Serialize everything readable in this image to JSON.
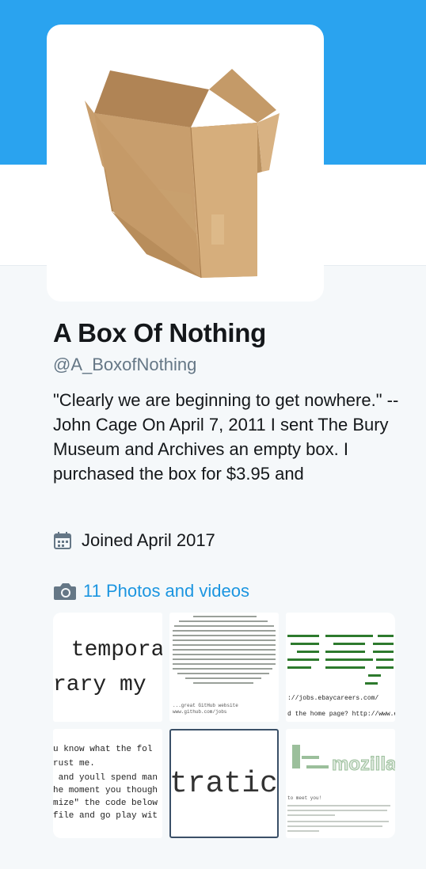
{
  "profile": {
    "name": "A Box Of Nothing",
    "handle": "@A_BoxofNothing",
    "bio": "\"Clearly we are beginning to get nowhere.\" --John Cage On April 7, 2011 I sent The Bury Museum and Archives an empty box. I purchased the box for $3.95 and",
    "joined": "Joined April 2017"
  },
  "media": {
    "label": "11 Photos and videos",
    "thumbnails": [
      {
        "line1": " tempora",
        "line2": "rary my"
      },
      {
        "caption1": "...great GitHub website",
        "caption2": "www.github.com/jobs"
      },
      {
        "line1": "://jobs.ebaycareers.com/",
        "line2": "d the home page? http://www.e"
      },
      {
        "l1": "u know what the fol",
        "l2": "rust me.",
        "l3": " and youll spend man",
        "l4": "he moment you though",
        "l5": "mize\" the code below",
        "l6": "file and go play wit"
      },
      {
        "text": "tratic"
      },
      {
        "logo": "mozilla",
        "caption": "to meet you!"
      }
    ]
  },
  "colors": {
    "banner": "#2aa3ef",
    "link": "#1b95e0",
    "muted": "#657786",
    "background": "#f5f8fa"
  },
  "icons": {
    "joined": "calendar-icon",
    "media": "camera-icon",
    "avatar": "cardboard-box-image"
  }
}
